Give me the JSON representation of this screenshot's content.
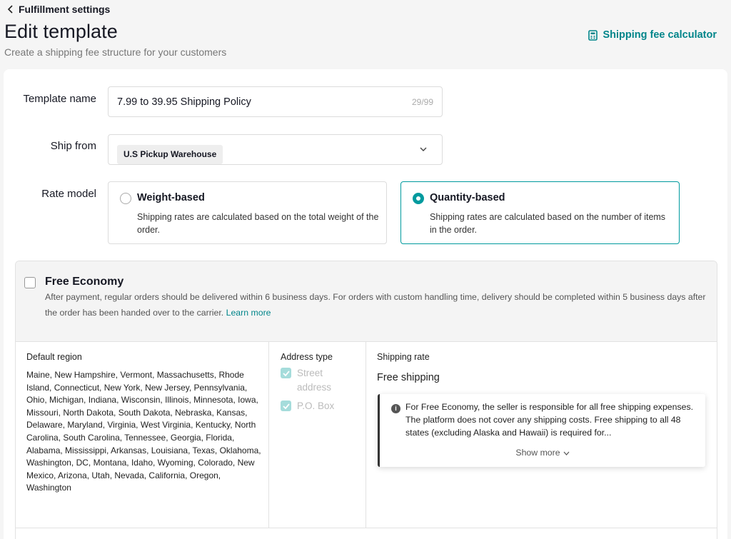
{
  "header": {
    "back_label": "Fulfillment settings",
    "title": "Edit template",
    "subtitle": "Create a shipping fee structure for your customers",
    "calculator_label": "Shipping fee calculator"
  },
  "form": {
    "template_name_label": "Template name",
    "template_name_value": "7.99 to 39.95 Shipping Policy",
    "template_name_count": "29/99",
    "ship_from_label": "Ship from",
    "ship_from_value": "U.S Pickup Warehouse",
    "rate_model_label": "Rate model",
    "rate_options": [
      {
        "title": "Weight-based",
        "desc": "Shipping rates are calculated based on the total weight of the order.",
        "selected": false
      },
      {
        "title": "Quantity-based",
        "desc": "Shipping rates are calculated based on the number of items in the order.",
        "selected": true
      }
    ]
  },
  "economy": {
    "title": "Free Economy",
    "desc": "After payment, regular orders should be delivered within 6 business days. For orders with custom handling time, delivery should be completed within 5 business days after the order has been handed over to the carrier.",
    "learn_more": "Learn more",
    "col_region": "Default region",
    "regions": "Maine, New Hampshire, Vermont, Massachusetts, Rhode Island, Connecticut, New York, New Jersey, Pennsylvania, Ohio, Michigan, Indiana, Wisconsin, Illinois, Minnesota, Iowa, Missouri, North Dakota, South Dakota, Nebraska, Kansas, Delaware, Maryland, Virginia, West Virginia, Kentucky, North Carolina, South Carolina, Tennessee, Georgia, Florida, Alabama, Mississippi, Arkansas, Louisiana, Texas, Oklahoma, Washington, DC, Montana, Idaho, Wyoming, Colorado, New Mexico, Arizona, Utah, Nevada, California, Oregon, Washington",
    "col_address": "Address type",
    "address_types": [
      "Street address",
      "P.O. Box"
    ],
    "col_rate": "Shipping rate",
    "rate_value": "Free shipping",
    "note": "For Free Economy, the seller is responsible for all free shipping expenses. The platform does not cover any shipping costs. Free shipping to all 48 states (excluding Alaska and Hawaii) is required for...",
    "show_more": "Show more"
  },
  "colors": {
    "accent": "#009a9e",
    "link": "#00858a"
  }
}
